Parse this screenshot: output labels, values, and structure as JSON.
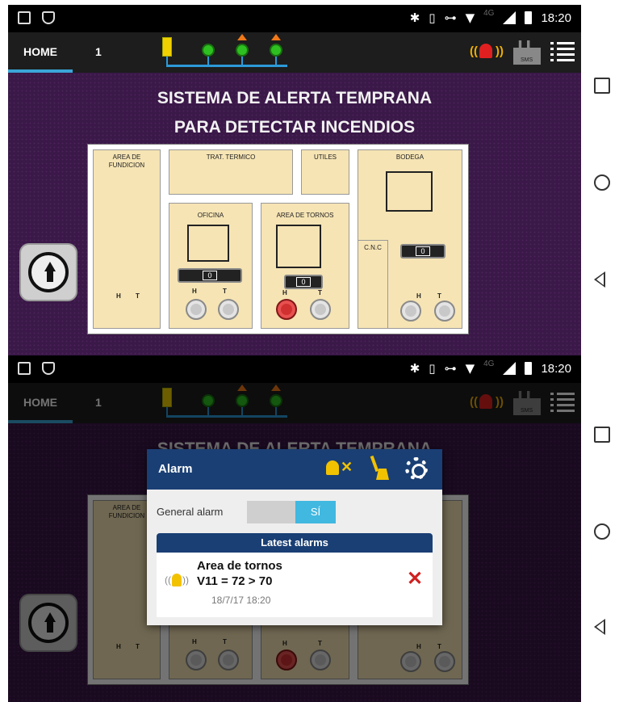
{
  "status": {
    "time": "18:20",
    "signal_label": "4G",
    "bluetooth": "✱",
    "vibrate": "▯",
    "key": "⊶",
    "wifi": "▼"
  },
  "tabs": {
    "home": "HOME",
    "page1": "1"
  },
  "title": {
    "line1": "SISTEMA DE ALERTA TEMPRANA",
    "line2": "PARA DETECTAR INCENDIOS"
  },
  "rooms": {
    "fundicion": "AREA DE FUNDICION",
    "trat_termico": "TRAT. TERMICO",
    "utiles": "UTILES",
    "bodega": "BODEGA",
    "oficina": "OFICINA",
    "tornos": "AREA DE TORNOS",
    "cnc": "C.N.C"
  },
  "readouts": {
    "oficina": "0",
    "tornos": "0",
    "bodega": "0"
  },
  "sensor_labels": {
    "h": "H",
    "t": "T"
  },
  "sms_label": "SMS",
  "icons": {
    "alarm": "alarm-bell-icon",
    "sms": "sms-factory-icon",
    "menu": "menu-list-icon",
    "up": "arrow-up-icon"
  },
  "colors": {
    "accent": "#3ba6d8",
    "dialog_header": "#1a3f74",
    "background": "#3a1848",
    "alarm_red": "#d03030"
  },
  "dialog": {
    "title": "Alarm",
    "general_alarm_label": "General alarm",
    "general_alarm_value": "SÍ",
    "latest_alarms_label": "Latest alarms",
    "alarm": {
      "name": "Area de tornos",
      "value": "V11 = 72  > 70",
      "time": "18/7/17  18:20",
      "bell_waves_left": "((",
      "bell_waves_right": "))"
    },
    "close_glyph": "✕",
    "bellx_glyph": "✕"
  },
  "alarm_waves": {
    "left": "((",
    "right": "))"
  }
}
